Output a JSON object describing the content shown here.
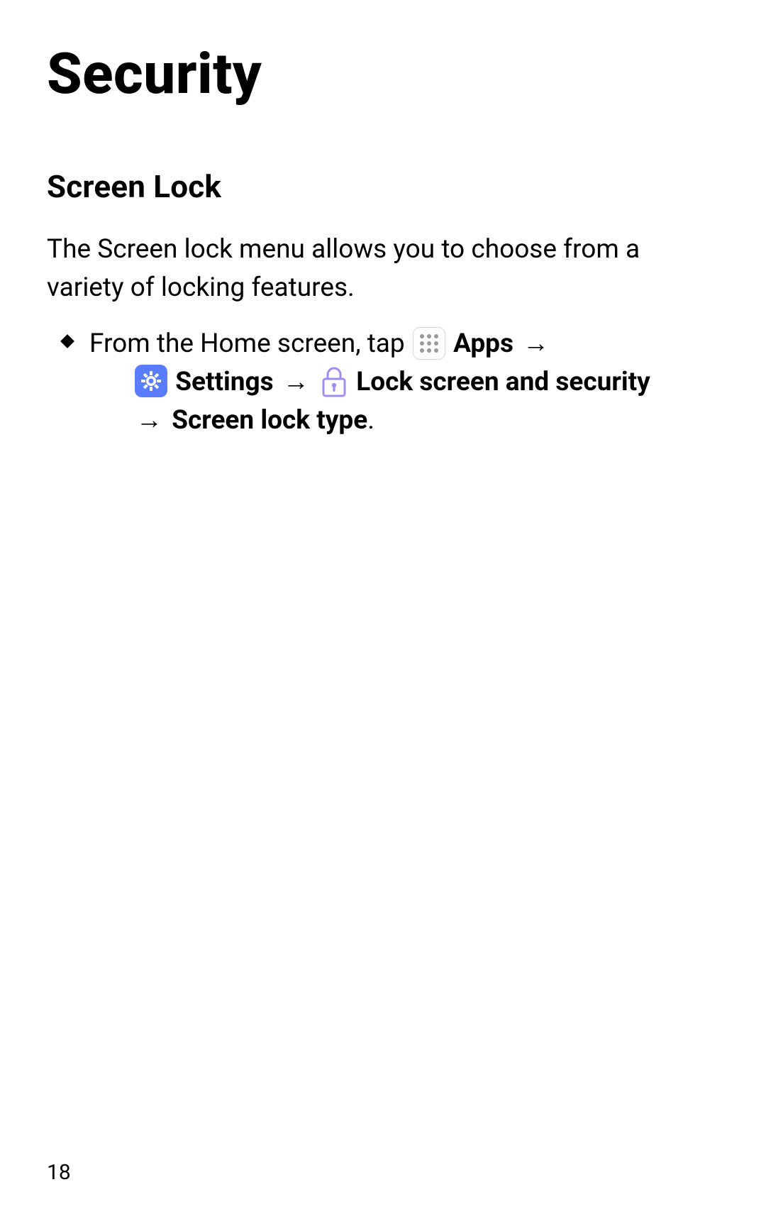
{
  "title": "Security",
  "section_heading": "Screen Lock",
  "intro": "The Screen lock menu allows you to choose from a variety of locking features.",
  "instruction": {
    "pre_apps": "From the Home screen, tap ",
    "apps_label": "Apps",
    "arrow": "→",
    "settings_label": "Settings",
    "lock_label": "Lock screen and security",
    "final_label": "Screen lock type",
    "period": "."
  },
  "page_number": "18",
  "icons": {
    "apps": "apps-grid-icon",
    "settings": "settings-gear-icon",
    "lock": "lock-outline-icon"
  }
}
